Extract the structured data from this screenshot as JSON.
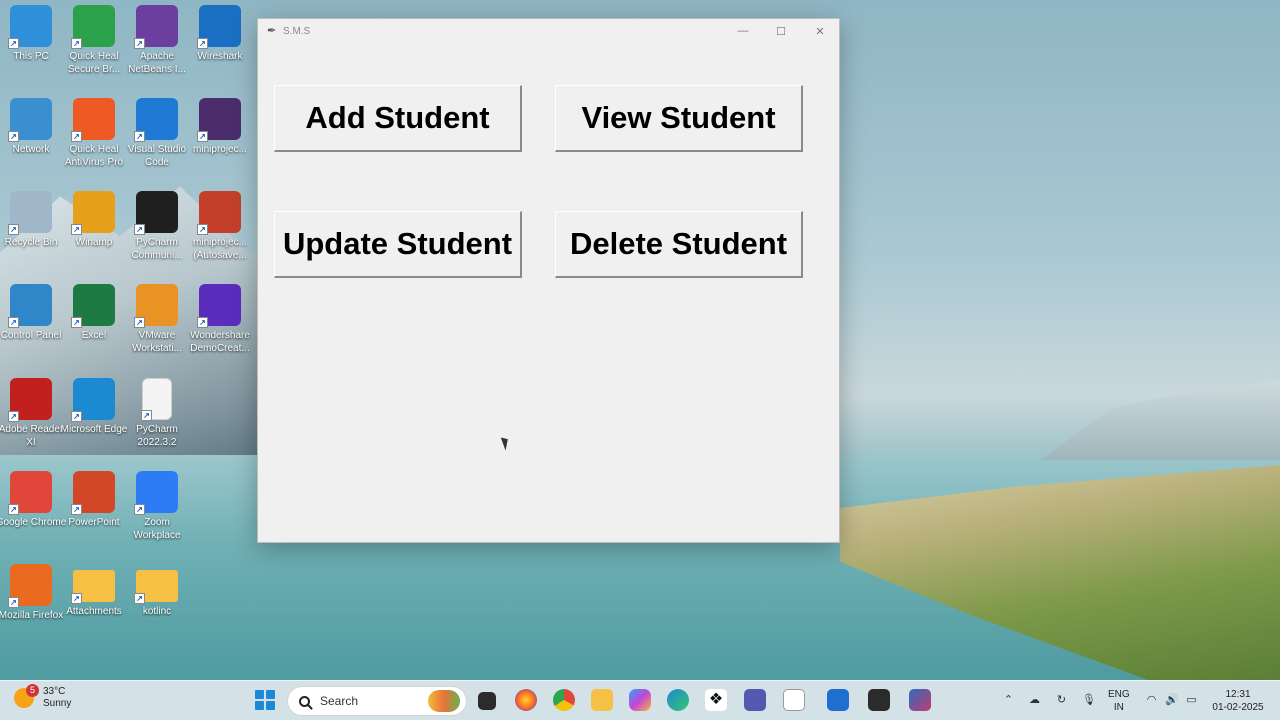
{
  "desktop": {
    "icons": [
      {
        "label": "This PC",
        "icon": "this-pc-icon",
        "color": "#2f8fd8"
      },
      {
        "label": "Quick Heal Secure Br...",
        "icon": "quick-heal-browser-icon",
        "color": "#2aa14a"
      },
      {
        "label": "Apache NetBeans I...",
        "icon": "netbeans-icon",
        "color": "#6b3fa0"
      },
      {
        "label": "Wireshark",
        "icon": "wireshark-icon",
        "color": "#1b6fc2"
      },
      {
        "label": "Network",
        "icon": "network-icon",
        "color": "#3a8fd1"
      },
      {
        "label": "Quick Heal AntiVirus Pro",
        "icon": "quick-heal-antivirus-icon",
        "color": "#ee5a24"
      },
      {
        "label": "Visual Studio Code",
        "icon": "vscode-icon",
        "color": "#1f7ad6"
      },
      {
        "label": "miniprojec...",
        "icon": "video-file-icon",
        "color": "#4b2d6e"
      },
      {
        "label": "Recycle Bin",
        "icon": "recycle-bin-icon",
        "color": "#9fb7c9"
      },
      {
        "label": "Winamp",
        "icon": "winamp-icon",
        "color": "#e5a11b"
      },
      {
        "label": "PyCharm Communi...",
        "icon": "pycharm-icon",
        "color": "#1f1f1f"
      },
      {
        "label": "miniprojec... (Autosave...",
        "icon": "powerpoint-file-icon",
        "color": "#c4402b"
      },
      {
        "label": "Control Panel",
        "icon": "control-panel-icon",
        "color": "#2f86c8"
      },
      {
        "label": "Excel",
        "icon": "excel-icon",
        "color": "#1d7a43"
      },
      {
        "label": "VMware Workstati...",
        "icon": "vmware-icon",
        "color": "#e89324"
      },
      {
        "label": "Wondershare DemoCreat...",
        "icon": "wondershare-icon",
        "color": "#5a2dbd"
      },
      {
        "label": "Adobe Reader XI",
        "icon": "adobe-reader-icon",
        "color": "#c21f1f"
      },
      {
        "label": "Microsoft Edge",
        "icon": "edge-icon",
        "color": "#1c8ad1"
      },
      {
        "label": "PyCharm 2022.3.2",
        "icon": "blank-file-icon",
        "color": "#f4f4f4"
      },
      {
        "label": "Google Chrome",
        "icon": "chrome-icon",
        "color": "#e0463a"
      },
      {
        "label": "PowerPoint",
        "icon": "powerpoint-icon",
        "color": "#d24726"
      },
      {
        "label": "Zoom Workplace",
        "icon": "zoom-icon",
        "color": "#2d7cf6"
      },
      {
        "label": "Mozilla Firefox",
        "icon": "firefox-icon",
        "color": "#ea6a1f"
      },
      {
        "label": "Attachments",
        "icon": "folder-icon",
        "color": "#f5c044"
      },
      {
        "label": "kotlinc",
        "icon": "folder-icon",
        "color": "#f5c044"
      }
    ]
  },
  "window": {
    "title": "S.M.S",
    "buttons": {
      "add": "Add Student",
      "view": "View Student",
      "update": "Update Student",
      "delete": "Delete Student"
    }
  },
  "taskbar": {
    "weather": {
      "temp": "33°C",
      "condition": "Sunny",
      "badge": "5"
    },
    "search_label": "Search",
    "tray": {
      "lang_top": "ENG",
      "lang_bottom": "IN",
      "time": "12:31",
      "date": "01-02-2025"
    }
  },
  "colors": {
    "window_bg": "#f0f0f0",
    "start_blue": "#1a8ad8"
  }
}
